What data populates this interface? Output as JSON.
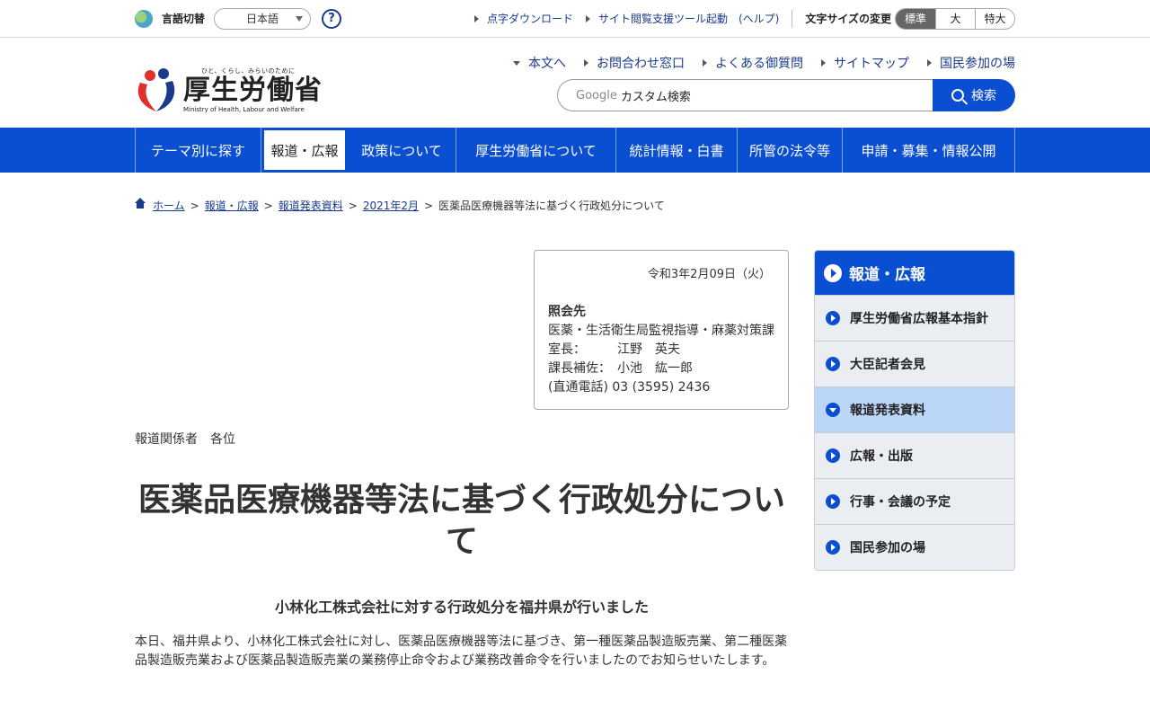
{
  "utility": {
    "lang_label": "言語切替",
    "lang_value": "日本語",
    "help_symbol": "?",
    "links": [
      "点字ダウンロード",
      "サイト閲覧支援ツール起動　(ヘルプ)"
    ],
    "fontsize_label": "文字サイズの変更",
    "fontsize_options": [
      "標準",
      "大",
      "特大"
    ],
    "fontsize_selected": "標準"
  },
  "header": {
    "logo_tagline": "ひと、くらし、みらいのために",
    "logo_name": "厚生労働省",
    "logo_english": "Ministry of Health, Labour and Welfare",
    "links": [
      "本文へ",
      "お問合わせ窓口",
      "よくある御質問",
      "サイトマップ",
      "国民参加の場"
    ],
    "search_brand": "Google",
    "search_placeholder": "カスタム検索",
    "search_button": "検索"
  },
  "gnav": {
    "items": [
      "テーマ別に探す",
      "報道・広報",
      "政策について",
      "厚生労働省について",
      "統計情報・白書",
      "所管の法令等",
      "申請・募集・情報公開"
    ],
    "active": "報道・広報"
  },
  "breadcrumb": {
    "items": [
      "ホーム",
      "報道・広報",
      "報道発表資料",
      "2021年2月"
    ],
    "current": "医薬品医療機器等法に基づく行政処分について",
    "separator": ">"
  },
  "contact": {
    "date": "令和3年2月09日（火）",
    "title": "照会先",
    "lines": [
      "医薬・生活衛生局監視指導・麻薬対策課",
      "室長：　　　江野　英夫",
      "課長補佐：　小池　紘一郎",
      "(直通電話) 03 (3595) 2436"
    ]
  },
  "article": {
    "recipients": "報道関係者　各位",
    "title": "医薬品医療機器等法に基づく行政処分について",
    "subtitle": "小林化工株式会社に対する行政処分を福井県が行いました",
    "body": "本日、福井県より、小林化工株式会社に対し、医薬品医療機器等法に基づき、第一種医薬品製造販売業、第二種医薬品製造販売業および医薬品製造販売業の業務停止命令および業務改善命令を行いましたのでお知らせいたします。"
  },
  "sidenav": {
    "title": "報道・広報",
    "items": [
      "厚生労働省広報基本指針",
      "大臣記者会見",
      "報道発表資料",
      "広報・出版",
      "行事・会議の予定",
      "国民参加の場"
    ],
    "active": "報道発表資料"
  },
  "colors": {
    "brand_blue": "#0a4ed2",
    "link_blue": "#1a3a8c",
    "side_active": "#bcd6f8"
  }
}
